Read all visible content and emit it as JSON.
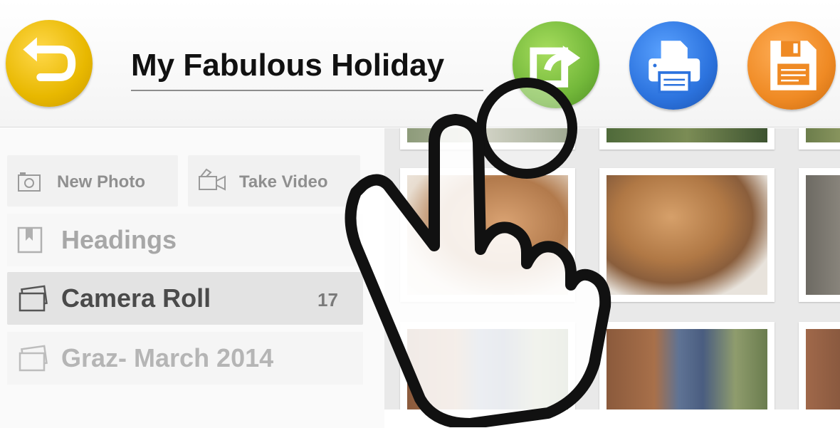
{
  "header": {
    "title": "My Fabulous Holiday",
    "back_icon": "back-arrow-icon",
    "share_icon": "share-icon",
    "print_icon": "printer-icon",
    "save_icon": "floppy-disk-icon",
    "colors": {
      "back": "#e8b800",
      "share": "#73b83a",
      "print": "#2c73de",
      "save": "#ef8a24"
    }
  },
  "sidebar": {
    "new_photo": {
      "label": "New Photo",
      "icon": "camera-icon"
    },
    "take_video": {
      "label": "Take Video",
      "icon": "video-camera-icon"
    },
    "items": [
      {
        "label": "Headings",
        "icon": "bookmark-icon",
        "count": ""
      },
      {
        "label": "Camera Roll",
        "icon": "photos-stack-icon",
        "count": "17"
      },
      {
        "label": "Graz- March 2014",
        "icon": "photos-stack-icon",
        "count": ""
      }
    ]
  },
  "overlay": {
    "icon": "tap-hand-icon"
  }
}
